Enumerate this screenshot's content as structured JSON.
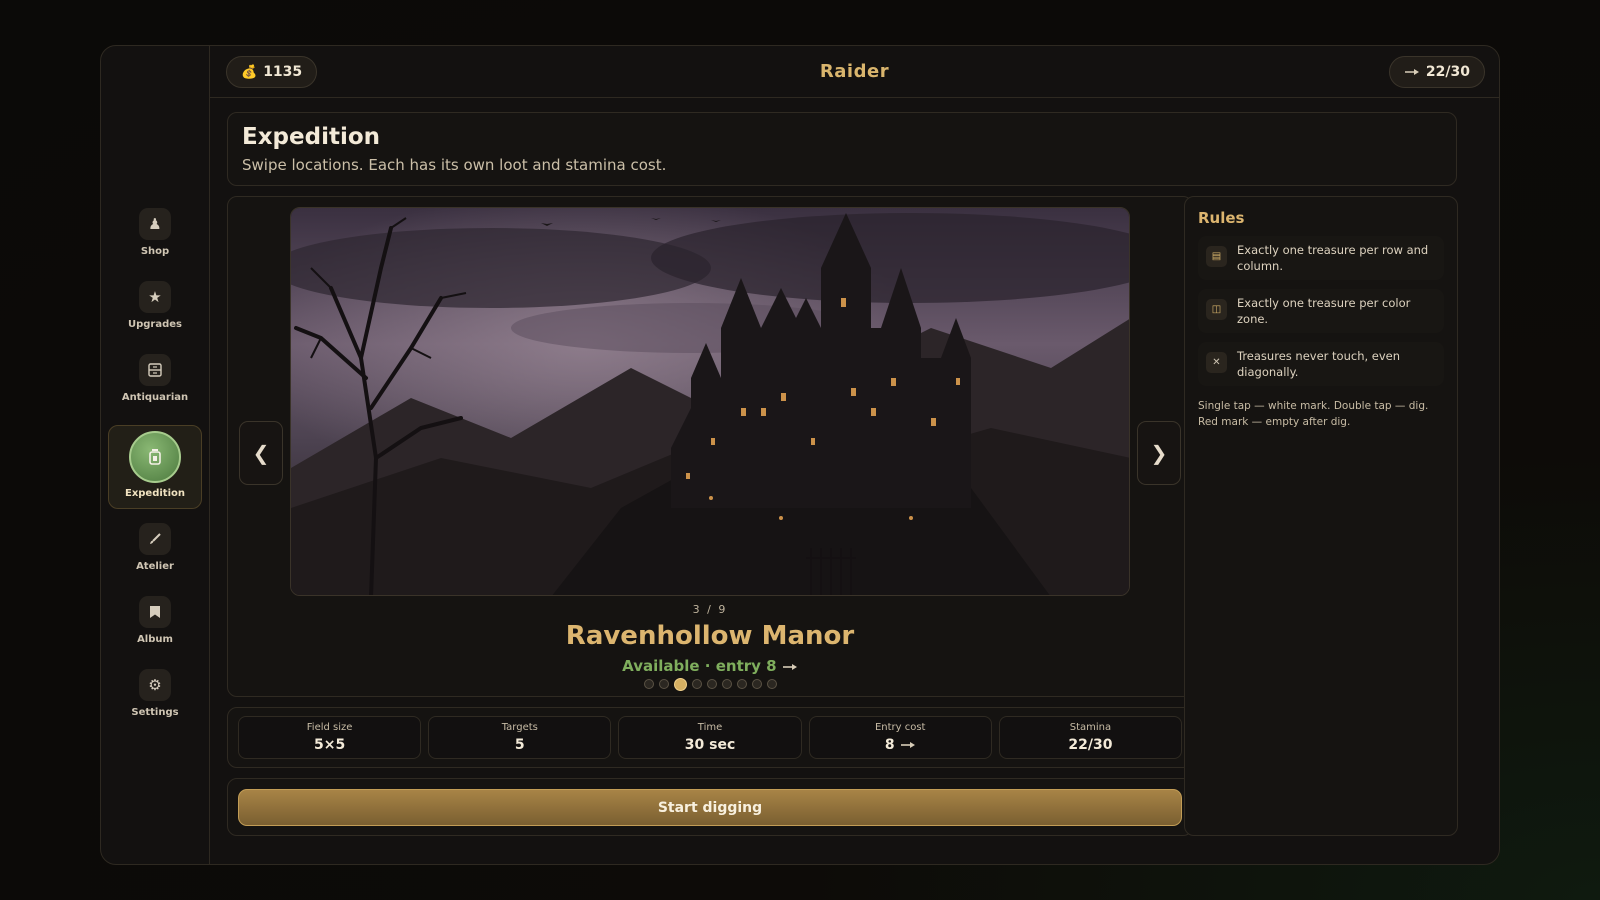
{
  "app": {
    "title": "Raider"
  },
  "topbar": {
    "coins": "1135",
    "coin_icon": "coin-bag-icon",
    "stamina": "22/30",
    "stamina_icon": "shovel-icon"
  },
  "nav": {
    "items": [
      {
        "label": "Shop",
        "icon": "shop-icon"
      },
      {
        "label": "Upgrades",
        "icon": "star-icon"
      },
      {
        "label": "Antiquarian",
        "icon": "cabinet-icon"
      },
      {
        "label": "Expedition",
        "icon": "lantern-icon",
        "active": true
      },
      {
        "label": "Atelier",
        "icon": "brush-icon"
      },
      {
        "label": "Album",
        "icon": "bookmark-icon"
      },
      {
        "label": "Settings",
        "icon": "gear-icon"
      }
    ]
  },
  "header": {
    "title": "Expedition",
    "subtitle": "Swipe locations. Each has its own loot and stamina cost."
  },
  "carousel": {
    "counter": "3 / 9",
    "current_index": 3,
    "total": 9,
    "location_name": "Ravenhollow Manor",
    "status": "Available · entry 8",
    "prev_label": "❮",
    "next_label": "❯"
  },
  "stats": [
    {
      "label": "Field size",
      "value": "5×5"
    },
    {
      "label": "Targets",
      "value": "5"
    },
    {
      "label": "Time",
      "value": "30 sec"
    },
    {
      "label": "Entry cost",
      "value": "8"
    },
    {
      "label": "Stamina",
      "value": "22/30"
    }
  ],
  "start_button": {
    "label": "Start digging"
  },
  "rules": {
    "title": "Rules",
    "items": [
      {
        "text": "Exactly one treasure per row and column.",
        "icon": "rows-icon"
      },
      {
        "text": "Exactly one treasure per color zone.",
        "icon": "zones-icon"
      },
      {
        "text": "Treasures never touch, even diagonally.",
        "icon": "cross-icon"
      }
    ],
    "note": "Single tap — white mark. Double tap — dig. Red mark — empty after dig."
  },
  "colors": {
    "accent": "#dcb56f",
    "available": "#7fae5d",
    "active_nav": "#6f9f5b"
  }
}
